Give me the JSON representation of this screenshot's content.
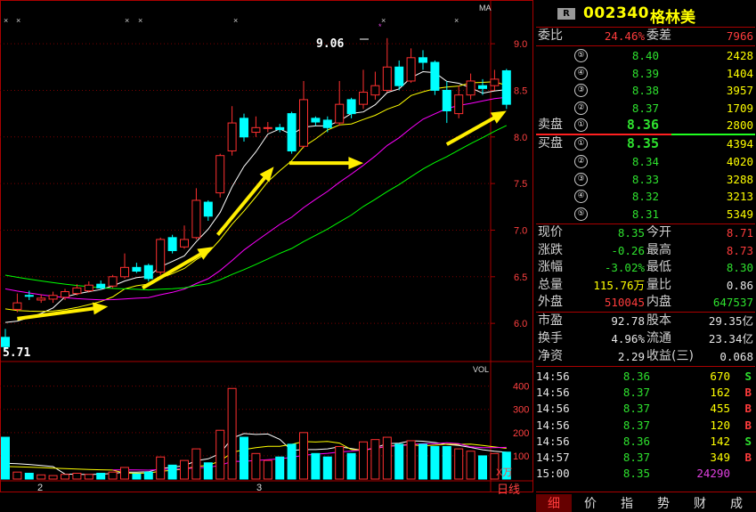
{
  "stock": {
    "badge": "R",
    "code": "002340",
    "name": "格林美"
  },
  "weibi": {
    "label1": "委比",
    "value1": "24.46%",
    "label2": "委差",
    "value2": "7966"
  },
  "sell_label": "卖盘",
  "buy_label": "买盘",
  "asks": [
    {
      "level": "⑤",
      "price": "8.40",
      "vol": "2428"
    },
    {
      "level": "④",
      "price": "8.39",
      "vol": "1404"
    },
    {
      "level": "③",
      "price": "8.38",
      "vol": "3957"
    },
    {
      "level": "②",
      "price": "8.37",
      "vol": "1709"
    },
    {
      "level": "①",
      "price": "8.36",
      "vol": "2800"
    }
  ],
  "bids": [
    {
      "level": "①",
      "price": "8.35",
      "vol": "4394"
    },
    {
      "level": "②",
      "price": "8.34",
      "vol": "4020"
    },
    {
      "level": "③",
      "price": "8.33",
      "vol": "3288"
    },
    {
      "level": "④",
      "price": "8.32",
      "vol": "3213"
    },
    {
      "level": "⑤",
      "price": "8.31",
      "vol": "5349"
    }
  ],
  "quote": [
    {
      "l1": "现价",
      "v1": "8.35",
      "c1": "green",
      "l2": "今开",
      "v2": "8.71",
      "c2": "red"
    },
    {
      "l1": "涨跌",
      "v1": "-0.26",
      "c1": "green",
      "l2": "最高",
      "v2": "8.73",
      "c2": "red"
    },
    {
      "l1": "涨幅",
      "v1": "-3.02%",
      "c1": "green",
      "l2": "最低",
      "v2": "8.30",
      "c2": "green"
    },
    {
      "l1": "总量",
      "v1": "115.76万",
      "c1": "yellow",
      "l2": "量比",
      "v2": "0.86",
      "c2": "white"
    },
    {
      "l1": "外盘",
      "v1": "510045",
      "c1": "red",
      "l2": "内盘",
      "v2": "647537",
      "c2": "green"
    }
  ],
  "finance": [
    {
      "l1": "市盈",
      "v1": "92.78",
      "l2": "股本",
      "v2": "29.35亿"
    },
    {
      "l1": "换手",
      "v1": "4.96%",
      "l2": "流通",
      "v2": "23.34亿"
    },
    {
      "l1": "净资",
      "v1": "2.29",
      "l2": "收益(三)",
      "v2": "0.068"
    }
  ],
  "ticks": [
    {
      "time": "14:56",
      "price": "8.36",
      "vol": "670",
      "side": "S"
    },
    {
      "time": "14:56",
      "price": "8.37",
      "vol": "162",
      "side": "B"
    },
    {
      "time": "14:56",
      "price": "8.37",
      "vol": "455",
      "side": "B"
    },
    {
      "time": "14:56",
      "price": "8.37",
      "vol": "120",
      "side": "B"
    },
    {
      "time": "14:56",
      "price": "8.36",
      "vol": "142",
      "side": "S"
    },
    {
      "time": "14:57",
      "price": "8.37",
      "vol": "349",
      "side": "B"
    },
    {
      "time": "15:00",
      "price": "8.35",
      "vol": "24290",
      "side": ""
    }
  ],
  "tabs": [
    "细",
    "价",
    "指",
    "势",
    "财",
    "成"
  ],
  "chart_labels": {
    "ma": "MA",
    "vol": "VOL",
    "unit": "X万",
    "period": "日线",
    "high_label": "9.06",
    "low_label": "5.71",
    "month1": "2",
    "month2": "3"
  },
  "chart_data": {
    "type": "candlestick",
    "price_ticks": [
      6.0,
      6.5,
      7.0,
      7.5,
      8.0,
      8.5,
      9.0
    ],
    "price_ylim": [
      5.6,
      9.45
    ],
    "vol_ticks": [
      100,
      200,
      300,
      400
    ],
    "vol_ylim": [
      0,
      460
    ],
    "candles": [
      [
        5.85,
        5.75,
        5.94,
        5.71,
        180
      ],
      [
        6.15,
        6.22,
        6.32,
        6.12,
        30
      ],
      [
        6.3,
        6.29,
        6.35,
        6.25,
        25
      ],
      [
        6.25,
        6.27,
        6.31,
        6.22,
        18
      ],
      [
        6.26,
        6.3,
        6.34,
        6.22,
        15
      ],
      [
        6.28,
        6.34,
        6.37,
        6.25,
        20
      ],
      [
        6.32,
        6.38,
        6.42,
        6.3,
        25
      ],
      [
        6.35,
        6.41,
        6.45,
        6.33,
        20
      ],
      [
        6.42,
        6.38,
        6.46,
        6.36,
        25
      ],
      [
        6.4,
        6.5,
        6.52,
        6.38,
        30
      ],
      [
        6.5,
        6.6,
        6.75,
        6.48,
        50
      ],
      [
        6.6,
        6.56,
        6.65,
        6.54,
        22
      ],
      [
        6.62,
        6.48,
        6.64,
        6.45,
        30
      ],
      [
        6.55,
        6.9,
        6.92,
        6.52,
        95
      ],
      [
        6.92,
        6.78,
        6.95,
        6.75,
        60
      ],
      [
        6.82,
        6.9,
        7.05,
        6.8,
        80
      ],
      [
        6.92,
        7.32,
        7.45,
        6.9,
        130
      ],
      [
        7.3,
        7.15,
        7.32,
        7.1,
        70
      ],
      [
        7.4,
        7.8,
        7.82,
        7.35,
        210
      ],
      [
        7.85,
        8.15,
        8.33,
        7.8,
        390
      ],
      [
        8.2,
        8.0,
        8.25,
        7.95,
        180
      ],
      [
        8.05,
        8.1,
        8.22,
        8.0,
        110
      ],
      [
        8.1,
        8.1,
        8.16,
        8.05,
        80
      ],
      [
        8.1,
        8.08,
        8.14,
        8.05,
        95
      ],
      [
        8.25,
        7.85,
        8.27,
        7.82,
        150
      ],
      [
        7.9,
        8.4,
        8.6,
        7.88,
        200
      ],
      [
        8.2,
        8.16,
        8.22,
        8.12,
        110
      ],
      [
        8.18,
        8.1,
        8.22,
        8.05,
        95
      ],
      [
        8.15,
        8.35,
        8.6,
        8.12,
        140
      ],
      [
        8.4,
        8.25,
        8.42,
        8.2,
        110
      ],
      [
        8.35,
        8.48,
        8.72,
        8.3,
        160
      ],
      [
        8.45,
        8.55,
        8.7,
        8.4,
        170
      ],
      [
        8.5,
        8.75,
        9.06,
        8.48,
        180
      ],
      [
        8.75,
        8.55,
        8.82,
        8.5,
        150
      ],
      [
        8.6,
        8.85,
        8.95,
        8.58,
        165
      ],
      [
        8.85,
        8.8,
        8.93,
        8.72,
        150
      ],
      [
        8.8,
        8.5,
        8.82,
        8.45,
        140
      ],
      [
        8.5,
        8.28,
        8.6,
        8.15,
        140
      ],
      [
        8.25,
        8.45,
        8.55,
        8.2,
        130
      ],
      [
        8.45,
        8.6,
        8.68,
        8.4,
        120
      ],
      [
        8.55,
        8.52,
        8.62,
        8.45,
        100
      ],
      [
        8.55,
        8.62,
        8.72,
        8.5,
        110
      ],
      [
        8.71,
        8.35,
        8.73,
        8.3,
        116
      ]
    ],
    "ma_colors": [
      "#ffffff",
      "#ffff00",
      "#ff00ff",
      "#00ff00"
    ],
    "vol_ma_colors": [
      "#ffffff",
      "#ffff00",
      "#ff00ff",
      "#00ff00"
    ],
    "annotation_arrows": [
      {
        "from": [
          1,
          6.05
        ],
        "to": [
          8.6,
          6.18
        ]
      },
      {
        "from": [
          11.5,
          6.38
        ],
        "to": [
          17.4,
          6.82
        ]
      },
      {
        "from": [
          17.8,
          6.95
        ],
        "to": [
          22.5,
          7.68
        ]
      },
      {
        "from": [
          23.8,
          7.72
        ],
        "to": [
          30.0,
          7.72
        ]
      },
      {
        "from": [
          37.0,
          7.92
        ],
        "to": [
          42.0,
          8.28
        ]
      }
    ]
  }
}
